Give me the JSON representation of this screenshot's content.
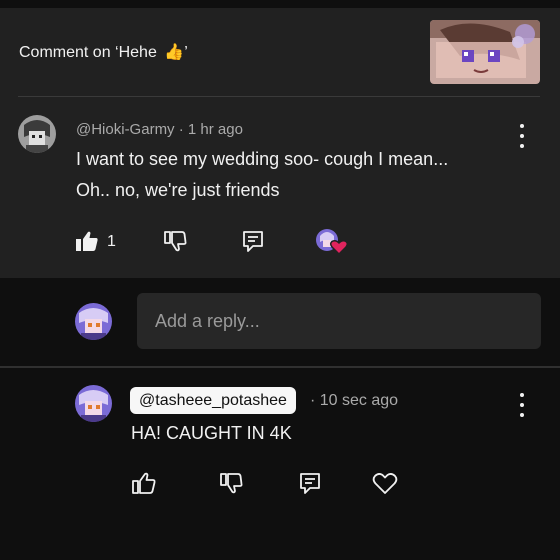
{
  "header": {
    "title": "Comment on ‘Hehe",
    "title_end": "’",
    "title_emoji": "👍"
  },
  "parent_comment": {
    "username": "@Hioki-Garmy",
    "separator": "·",
    "time": "1 hr ago",
    "text_line1": "I want to see my wedding soo- cough I mean...",
    "text_line2": "Oh.. no, we're just friends",
    "like_count": "1"
  },
  "reply_box": {
    "placeholder": "Add a reply..."
  },
  "reply_comment": {
    "username": "@tasheee_potashee",
    "separator": "·",
    "time": "10 sec ago",
    "text": "HA! CAUGHT IN 4K"
  },
  "colors": {
    "card_bg": "#212121",
    "page_bg": "#0f0f0f",
    "heart_red": "#e0245e",
    "avatar_purple": "#7b6bd6"
  },
  "icons": [
    "like-icon",
    "dislike-icon",
    "reply-icon",
    "creator-heart-icon",
    "heart-icon",
    "more-vert-icon"
  ]
}
